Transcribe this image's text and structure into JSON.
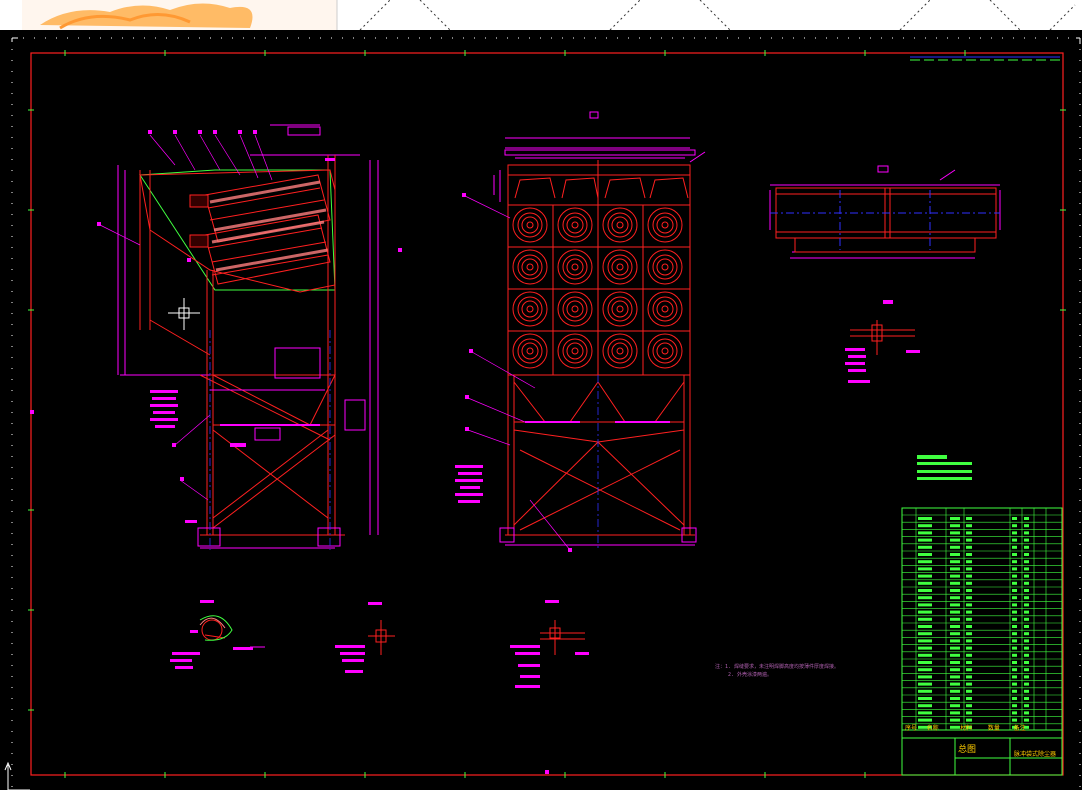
{
  "drawing": {
    "title_block": {
      "header_cells": [
        "序号",
        "名称",
        "材料",
        "数量",
        "备注"
      ],
      "drawing_title": "总图",
      "project_name": "脉冲袋式除尘器"
    },
    "notes": {
      "line1": "注：1. 焊缝要求，未注明焊脚高度均按薄件厚度焊接。",
      "line2": "2. 外壳涂漆两遍。"
    }
  },
  "colors": {
    "background": "#000000",
    "frame": "#ff2020",
    "geometry": "#ff2020",
    "dimension": "#ff00ff",
    "table": "#40ff40",
    "center_line": "#3030ff",
    "accent_yellow": "#ffcc00"
  },
  "icons": [
    "crosshair-cursor-icon",
    "ucs-axis-icon"
  ]
}
